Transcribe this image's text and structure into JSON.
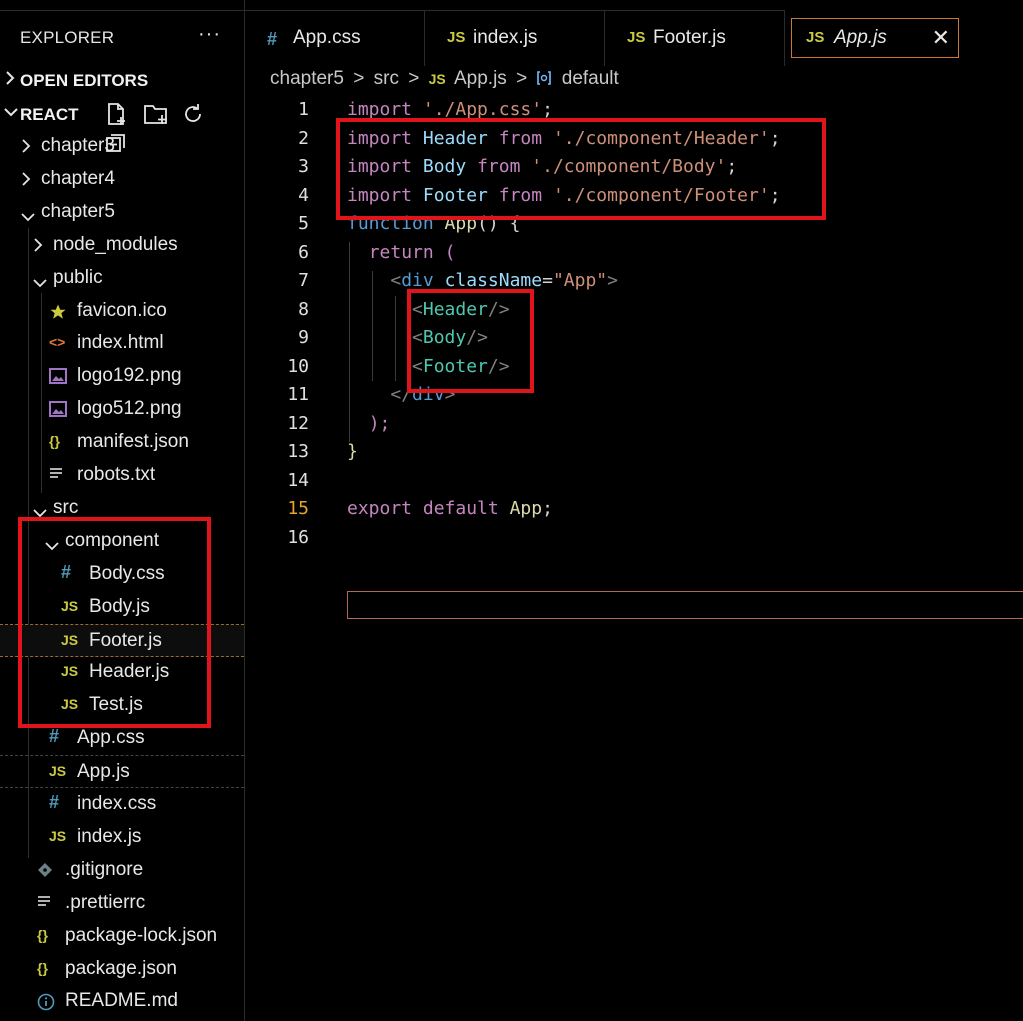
{
  "explorer": {
    "title": "EXPLORER",
    "more": "···"
  },
  "sections": {
    "open_editors": "OPEN EDITORS",
    "project": "REACT"
  },
  "tree": [
    {
      "label": "chapter3",
      "icon": "chevron-right",
      "indent": 0
    },
    {
      "label": "chapter4",
      "icon": "chevron-right",
      "indent": 0
    },
    {
      "label": "chapter5",
      "icon": "chevron-down",
      "indent": 0
    },
    {
      "label": "node_modules",
      "icon": "chevron-right",
      "indent": 1
    },
    {
      "label": "public",
      "icon": "chevron-down",
      "indent": 1
    },
    {
      "label": "favicon.ico",
      "icon": "star",
      "indent": 2
    },
    {
      "label": "index.html",
      "icon": "html",
      "indent": 2
    },
    {
      "label": "logo192.png",
      "icon": "image",
      "indent": 2
    },
    {
      "label": "logo512.png",
      "icon": "image",
      "indent": 2
    },
    {
      "label": "manifest.json",
      "icon": "json",
      "indent": 2
    },
    {
      "label": "robots.txt",
      "icon": "text",
      "indent": 2
    },
    {
      "label": "src",
      "icon": "chevron-down",
      "indent": 1
    },
    {
      "label": "component",
      "icon": "chevron-down",
      "indent": 2
    },
    {
      "label": "Body.css",
      "icon": "css",
      "indent": 3
    },
    {
      "label": "Body.js",
      "icon": "js",
      "indent": 3
    },
    {
      "label": "Footer.js",
      "icon": "js",
      "indent": 3
    },
    {
      "label": "Header.js",
      "icon": "js",
      "indent": 3
    },
    {
      "label": "Test.js",
      "icon": "js",
      "indent": 3
    },
    {
      "label": "App.css",
      "icon": "css",
      "indent": 2
    },
    {
      "label": "App.js",
      "icon": "js",
      "indent": 2
    },
    {
      "label": "index.css",
      "icon": "css",
      "indent": 2
    },
    {
      "label": "index.js",
      "icon": "js",
      "indent": 2
    },
    {
      "label": ".gitignore",
      "icon": "git",
      "indent": 1
    },
    {
      "label": ".prettierrc",
      "icon": "text",
      "indent": 1
    },
    {
      "label": "package-lock.json",
      "icon": "json",
      "indent": 1
    },
    {
      "label": "package.json",
      "icon": "json",
      "indent": 1
    },
    {
      "label": "README.md",
      "icon": "info",
      "indent": 1
    }
  ],
  "icon_glyphs": {
    "js": "JS",
    "css": "#",
    "json": "{}",
    "html": "<>"
  },
  "tabs": [
    {
      "label": "App.css",
      "icon": "css"
    },
    {
      "label": "index.js",
      "icon": "js"
    },
    {
      "label": "Footer.js",
      "icon": "js"
    },
    {
      "label": "App.js",
      "icon": "js",
      "active": true
    }
  ],
  "tab_close": "✕",
  "breadcrumb": {
    "folder": "chapter5",
    "sub": "src",
    "file": "App.js",
    "symbol": "default",
    "sep": ">"
  },
  "code": {
    "l1": {
      "n": "1",
      "kw": "import",
      "str": "'./App.css'",
      "end": ";"
    },
    "l2": {
      "n": "2",
      "kw": "import",
      "id": "Header",
      "from": "from",
      "str": "'./component/Header'",
      "end": ";"
    },
    "l3": {
      "n": "3",
      "kw": "import",
      "id": "Body",
      "from": "from",
      "str": "'./component/Body'",
      "end": ";"
    },
    "l4": {
      "n": "4",
      "kw": "import",
      "id": "Footer",
      "from": "from",
      "str": "'./component/Footer'",
      "end": ";"
    },
    "l5": {
      "n": "5",
      "kw": "function",
      "fn": "App",
      "rest": "() {"
    },
    "l6": {
      "n": "6",
      "kw": "return",
      "rest": "("
    },
    "l7": {
      "n": "7",
      "open": "<",
      "tag": "div",
      "attr": "className",
      "eq": "=",
      "str": "\"App\"",
      "close": ">"
    },
    "l8": {
      "n": "8",
      "open": "<",
      "tag": "Header",
      "close": "/>"
    },
    "l9": {
      "n": "9",
      "open": "<",
      "tag": "Body",
      "close": "/>"
    },
    "l10": {
      "n": "10",
      "open": "<",
      "tag": "Footer",
      "close": "/>"
    },
    "l11": {
      "n": "11",
      "open": "</",
      "tag": "div",
      "close": ">"
    },
    "l12": {
      "n": "12",
      "rest": ");"
    },
    "l13": {
      "n": "13",
      "rest": "}"
    },
    "l14": {
      "n": "14"
    },
    "l15": {
      "n": "15",
      "kw": "export",
      "kw2": "default",
      "id": "App",
      "end": ";"
    },
    "l16": {
      "n": "16"
    }
  },
  "colors": {
    "accent_box": "#e0141b",
    "current_line_number": "#e5a526"
  }
}
